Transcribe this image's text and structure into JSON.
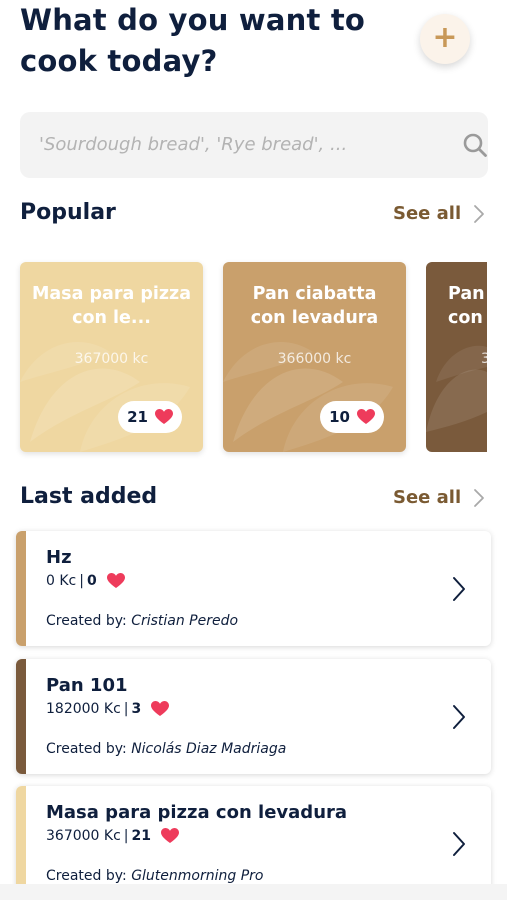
{
  "header": {
    "title": "What do you want to cook today?",
    "add_icon": "plus-icon"
  },
  "search": {
    "placeholder": "'Sourdough bread', 'Rye bread', ...",
    "icon": "search-icon"
  },
  "popular": {
    "title": "Popular",
    "see_all": "See all",
    "cards": [
      {
        "title": "Masa para pizza con le...",
        "kc": "367000 kc",
        "likes": "21",
        "color": "#efd7a1"
      },
      {
        "title": "Pan ciabatta con levadura",
        "kc": "366000 kc",
        "likes": "10",
        "color": "#c9a06c"
      },
      {
        "title": "Pan con",
        "kc": "3",
        "likes": "",
        "color": "#7a5a3c"
      }
    ]
  },
  "last_added": {
    "title": "Last added",
    "see_all": "See all",
    "items": [
      {
        "name": "Hz",
        "kc": "0 Kc",
        "likes": "0",
        "created_label": "Created by:",
        "author": "Cristian Peredo",
        "color": "#c9a06c"
      },
      {
        "name": "Pan 101",
        "kc": "182000 Kc",
        "likes": "3",
        "created_label": "Created by:",
        "author": "Nicolás Diaz Madriaga",
        "color": "#7a5a3c"
      },
      {
        "name": "Masa para pizza con levadura",
        "kc": "367000 Kc",
        "likes": "21",
        "created_label": "Created by:",
        "author": "Glutenmorning Pro",
        "color": "#efd7a1"
      }
    ]
  },
  "colors": {
    "heart": "#ee3b5b",
    "accent": "#7a5a32",
    "text": "#0f1f3d"
  }
}
